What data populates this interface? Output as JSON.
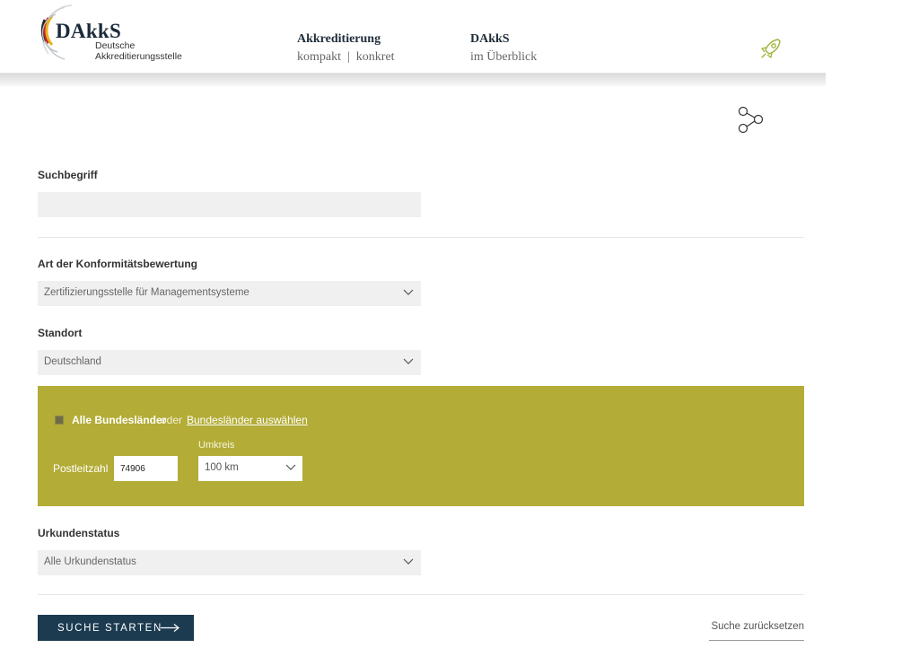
{
  "header": {
    "logo": {
      "wordmark": "DAkkS",
      "line1": "Deutsche",
      "line2": "Akkreditierungsstelle"
    },
    "nav": [
      {
        "title": "Akkreditierung",
        "subtitle": "kompakt  |  konkret"
      },
      {
        "title": "DAkkS",
        "subtitle": "im Überblick"
      }
    ],
    "rocket_icon": "rocket-icon",
    "accent_color": "#9fb23a"
  },
  "share_icon": "share-icon",
  "form": {
    "search": {
      "label": "Suchbegriff",
      "value": ""
    },
    "konformitaet": {
      "label": "Art der Konformitätsbewertung",
      "selected": "Zertifizierungsstelle für Managementsysteme"
    },
    "standort": {
      "label": "Standort",
      "selected": "Deutschland"
    },
    "region": {
      "all_label": "Alle Bundesländer",
      "or_text": "oder",
      "select_link": "Bundesländer auswählen",
      "plz_label": "Postleitzahl",
      "plz_value": "74906",
      "umkreis_label": "Umkreis",
      "umkreis_value": "100 km",
      "panel_color": "#b3ac36"
    },
    "urkundenstatus": {
      "label": "Urkundenstatus",
      "selected": "Alle Urkundenstatus"
    }
  },
  "actions": {
    "start_label": "SUCHE STARTEN",
    "reset_label": "Suche zurücksetzen",
    "start_color": "#1c3b50"
  }
}
